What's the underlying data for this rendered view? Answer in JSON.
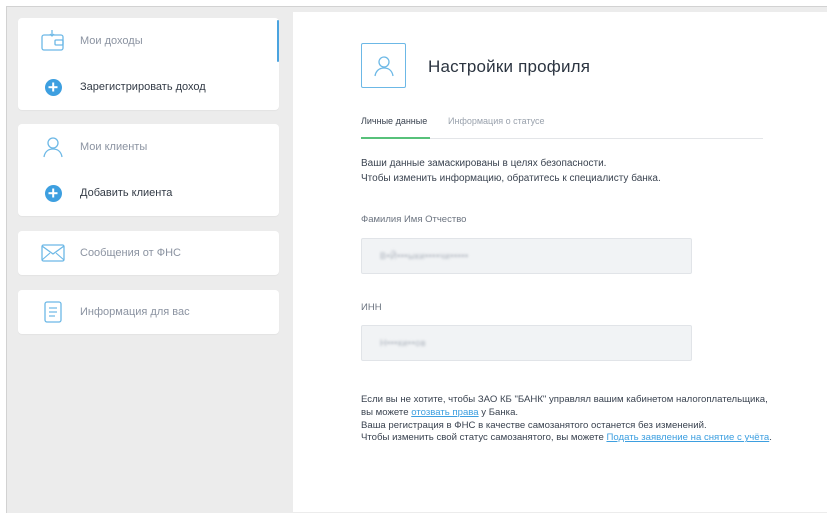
{
  "sidebar": {
    "group1": {
      "my_income": "Мои доходы",
      "register_income": "Зарегистрировать доход"
    },
    "group2": {
      "my_clients": "Мои клиенты",
      "add_client": "Добавить клиента"
    },
    "messages": "Сообщения от ФНС",
    "info": "Информация для вас"
  },
  "page": {
    "title": "Настройки профиля",
    "tabs": [
      {
        "label": "Личные данные",
        "active": true
      },
      {
        "label": "Информация о статусе",
        "active": false
      }
    ],
    "notice_line1": "Ваши данные замаскированы в целях безопасности.",
    "notice_line2": "Чтобы изменить информацию, обратитесь к специалисту банка.",
    "fio_label": "Фамилия Имя Отчество",
    "fio_value": "В•Й•••ыки••••чи•••••",
    "inn_label": "ИНН",
    "inn_value": "Н•••ки••ов"
  },
  "footer": {
    "p1_before": "Если вы не хотите, чтобы ЗАО КБ \"БАНК\" управлял вашим кабинетом налогоплательщика, вы можете ",
    "p1_link": "отозвать права",
    "p1_after": " у Банка.",
    "p2": "Ваша регистрация в ФНС в качестве самозанятого останется без изменений.",
    "p3_before": "Чтобы изменить свой статус самозанятого, вы можете ",
    "p3_link": "Подать заявление на снятие с учёта",
    "p3_after": "."
  },
  "colors": {
    "accent": "#3d9fe0",
    "tab_active": "#57c17a",
    "icon_outline": "#6cb8e6"
  }
}
